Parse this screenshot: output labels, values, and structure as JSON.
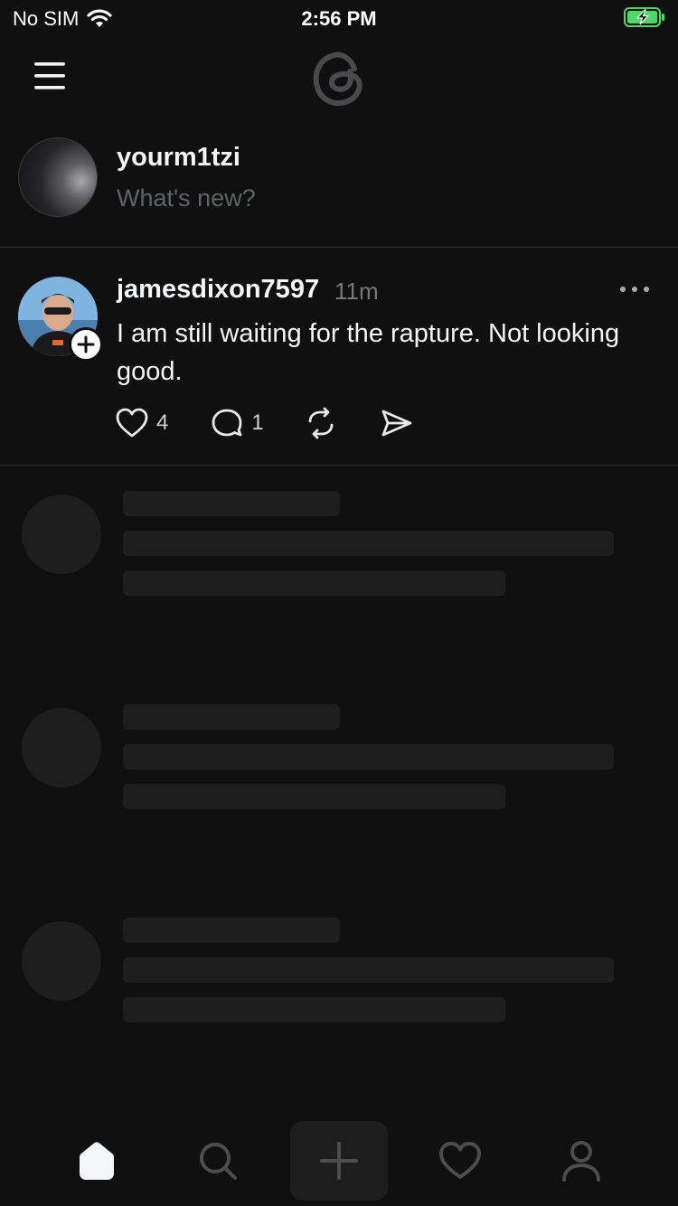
{
  "status_bar": {
    "carrier": "No SIM",
    "time": "2:56 PM",
    "battery_color": "#4cd964"
  },
  "composer": {
    "username": "yourm1tzi",
    "placeholder": "What's new?"
  },
  "post": {
    "username": "jamesdixon7597",
    "time": "11m",
    "text": "I am still waiting for the rapture. Not looking good.",
    "likes": "4",
    "replies": "1"
  },
  "icons": {
    "menu": "menu-icon",
    "logo": "threads-logo",
    "like": "heart-icon",
    "reply": "comment-icon",
    "repost": "repost-icon",
    "share": "send-icon",
    "more": "more-icon",
    "follow": "plus-icon"
  },
  "bottom_nav": [
    {
      "name": "home",
      "icon": "home-icon",
      "active": true
    },
    {
      "name": "search",
      "icon": "search-icon",
      "active": false
    },
    {
      "name": "create",
      "icon": "plus-icon",
      "active": false
    },
    {
      "name": "activity",
      "icon": "heart-icon",
      "active": false
    },
    {
      "name": "profile",
      "icon": "person-icon",
      "active": false
    }
  ]
}
